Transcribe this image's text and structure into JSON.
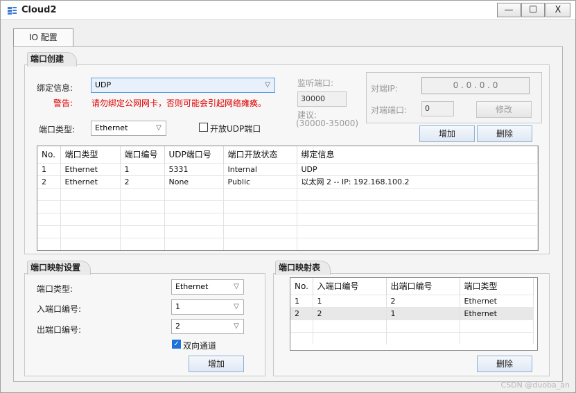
{
  "window": {
    "title": "Cloud2",
    "minimize": "—",
    "maximize": "☐",
    "close": "X"
  },
  "tab": {
    "label": "IO 配置"
  },
  "port_create": {
    "group_title": "端口创建",
    "bind_label": "绑定信息:",
    "bind_value": "UDP",
    "warn_label": "警告:",
    "warn_text": "请勿绑定公网网卡，否则可能会引起网络瘫痪。",
    "port_type_label": "端口类型:",
    "port_type_value": "Ethernet",
    "open_udp_label": "开放UDP端口",
    "listen_label": "监听端口:",
    "listen_value": "30000",
    "suggest_label": "建议:",
    "suggest_range": "(30000-35000)",
    "peer_ip_label": "对端IP:",
    "peer_ip_value": "0 . 0 . 0 . 0",
    "peer_port_label": "对端端口:",
    "peer_port_value": "0",
    "modify_button": "修改",
    "add_button": "增加",
    "delete_button": "删除",
    "table": {
      "headers": [
        "No.",
        "端口类型",
        "端口编号",
        "UDP端口号",
        "端口开放状态",
        "绑定信息"
      ],
      "rows": [
        [
          "1",
          "Ethernet",
          "1",
          "5331",
          "Internal",
          "UDP"
        ],
        [
          "2",
          "Ethernet",
          "2",
          "None",
          "Public",
          "以太网 2 -- IP: 192.168.100.2"
        ]
      ]
    }
  },
  "port_map_settings": {
    "group_title": "端口映射设置",
    "port_type_label": "端口类型:",
    "port_type_value": "Ethernet",
    "in_port_label": "入端口编号:",
    "in_port_value": "1",
    "out_port_label": "出端口编号:",
    "out_port_value": "2",
    "bidirectional_label": "双向通道",
    "bidirectional_checked": true,
    "add_button": "增加"
  },
  "port_map_table": {
    "group_title": "端口映射表",
    "headers": [
      "No.",
      "入端口编号",
      "出端口编号",
      "端口类型"
    ],
    "rows": [
      [
        "1",
        "1",
        "2",
        "Ethernet"
      ],
      [
        "2",
        "2",
        "1",
        "Ethernet"
      ]
    ],
    "delete_button": "删除"
  },
  "watermark": "CSDN @duoba_an"
}
